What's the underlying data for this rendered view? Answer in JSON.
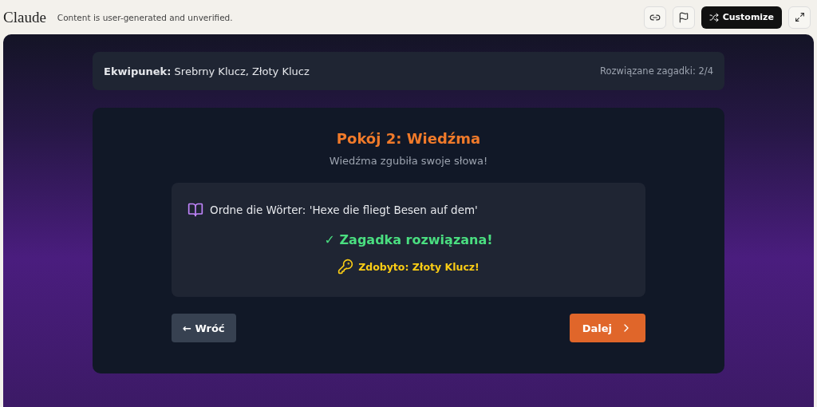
{
  "topbar": {
    "logo": "Claude",
    "notice": "Content is user-generated and unverified.",
    "customize": "Customize"
  },
  "status": {
    "inventory_label": "Ekwipunek:",
    "inventory": "Srebrny Klucz, Złoty Klucz",
    "solved": "Rozwiązane zagadki: 2/4"
  },
  "room": {
    "title": "Pokój 2: Wiedźma",
    "subtitle": "Wiedźma zgubiła swoje słowa!",
    "puzzle": "Ordne die Wörter: 'Hexe die fliegt Besen auf dem'",
    "solved": true,
    "result": "✓ Zagadka rozwiązana!",
    "reward": "Zdobyto: Złoty Klucz!"
  },
  "nav": {
    "back": "← Wróć",
    "next": "Dalej"
  }
}
